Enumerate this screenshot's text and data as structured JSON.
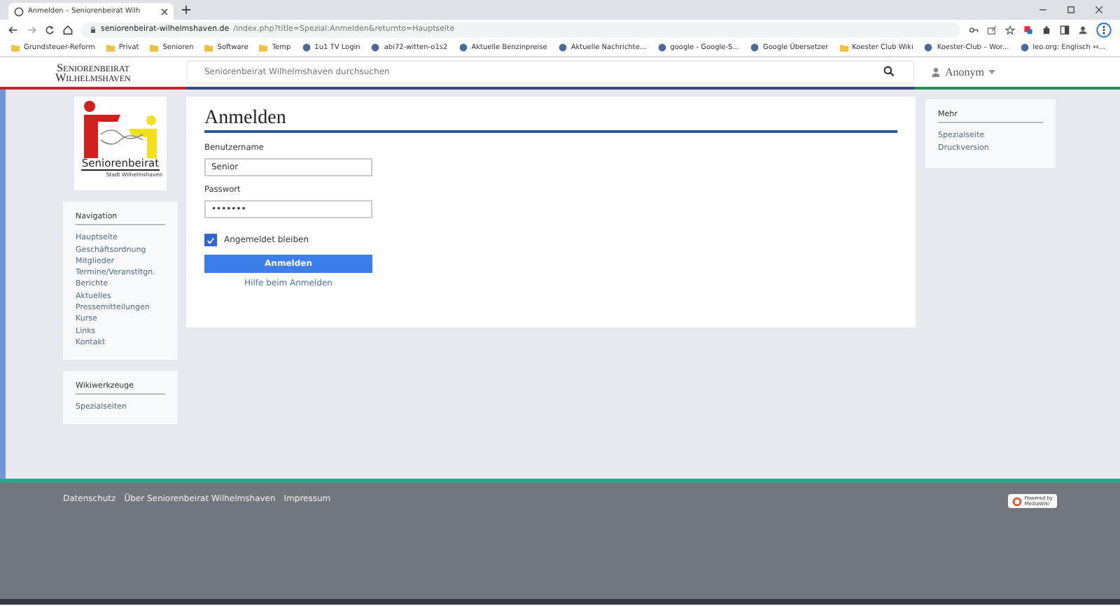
{
  "browser": {
    "tabs": [
      {
        "title": "Anmelden – Seniorenbeirat Wilh",
        "selected": true
      }
    ],
    "url_host": "seniorenbeirat-wilhelmshaven.de",
    "url_path": "/index.php?title=Spezial:Anmelden&returnto=Hauptseite",
    "bookmarks": [
      {
        "label": "Grundsteuer-Reform",
        "kind": "folder"
      },
      {
        "label": "Privat",
        "kind": "folder"
      },
      {
        "label": "Senioren",
        "kind": "folder"
      },
      {
        "label": "Software",
        "kind": "folder"
      },
      {
        "label": "Temp",
        "kind": "folder"
      },
      {
        "label": "1u1 TV Login",
        "kind": "site"
      },
      {
        "label": "abi72-witten-o1s2",
        "kind": "site"
      },
      {
        "label": "Aktuelle Benzinpreise",
        "kind": "site"
      },
      {
        "label": "Aktuelle Nachrichte...",
        "kind": "site"
      },
      {
        "label": "google - Google-S...",
        "kind": "site"
      },
      {
        "label": "Google Übersetzer",
        "kind": "site"
      },
      {
        "label": "Koester Club Wiki",
        "kind": "folder"
      },
      {
        "label": "Koester-Club – Wor...",
        "kind": "site"
      },
      {
        "label": "leo.org: Englisch ⇔...",
        "kind": "site"
      }
    ]
  },
  "site": {
    "logo_line1": "Seniorenbeirat",
    "logo_line2": "Wilhelmshaven",
    "search": {
      "placeholder": "Seniorenbeirat Wilhelmshaven durchsuchen"
    },
    "user": "Anonym"
  },
  "sidebar": {
    "logo_text": "Seniorenbeirat",
    "logo_subtext": "Stadt Wilhelmshaven",
    "sections": [
      {
        "title": "Navigation",
        "items": [
          "Hauptseite",
          "Geschäftsordnung",
          "Mitglieder",
          "Termine/Veranstltgn.",
          "Berichte",
          "Aktuelles",
          "Pressemitteilungen",
          "Kurse",
          "Links",
          "Kontakt"
        ]
      },
      {
        "title": "Wikiwerkzeuge",
        "items": [
          "Spezialseiten"
        ]
      }
    ]
  },
  "main": {
    "title": "Anmelden",
    "username_label": "Benutzername",
    "username_value": "Senior",
    "password_label": "Passwort",
    "password_value": "•••••••",
    "remember": {
      "label": "Angemeldet bleiben",
      "checked": true
    },
    "submit": "Anmelden",
    "help_link": "Hilfe beim Anmelden"
  },
  "right_panel": {
    "title": "Mehr",
    "items": [
      "Spezialseite",
      "Druckversion"
    ]
  },
  "footer": {
    "links": [
      "Datenschutz",
      "Über Seniorenbeirat Wilhelmshaven",
      "Impressum"
    ],
    "badge_line1": "Powered by",
    "badge_line2": "MediaWiki"
  }
}
